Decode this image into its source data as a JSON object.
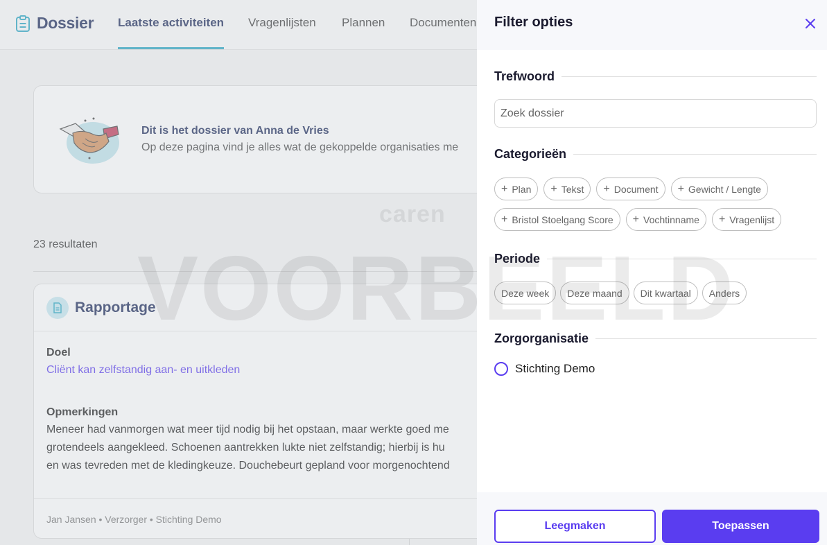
{
  "header": {
    "brand": "Dossier",
    "tabs": [
      {
        "label": "Laatste activiteiten",
        "active": true
      },
      {
        "label": "Vragenlijsten"
      },
      {
        "label": "Plannen"
      },
      {
        "label": "Documenten"
      }
    ]
  },
  "intro": {
    "title": "Dit is het dossier van Anna de Vries",
    "text": "Op deze pagina vind je alles wat de gekoppelde organisaties me"
  },
  "watermarks": {
    "logo": "caren",
    "overlay": "VOORBEELD"
  },
  "results": "23 resultaten",
  "report": {
    "title": "Rapportage",
    "doel_label": "Doel",
    "doel_value": "Cliënt kan zelfstandig aan- en uitkleden",
    "opmerkingen_label": "Opmerkingen",
    "opmerkingen_lines": [
      "Meneer had vanmorgen wat meer tijd nodig bij het opstaan, maar werkte goed me",
      "grotendeels aangekleed. Schoenen aantrekken lukte niet zelfstandig; hierbij is hu",
      "en was tevreden met de kledingkeuze. Douchebeurt gepland voor morgenochtend"
    ],
    "footer": "Jan Jansen • Verzorger •  Stichting Demo"
  },
  "filter": {
    "title": "Filter opties",
    "trefwoord": {
      "title": "Trefwoord",
      "placeholder": "Zoek dossier"
    },
    "categories": {
      "title": "Categorieën",
      "row1": [
        "Plan",
        "Tekst",
        "Document",
        "Gewicht / Lengte"
      ],
      "row2": [
        "Bristol Stoelgang Score",
        "Vochtinname",
        "Vragenlijst"
      ]
    },
    "periode": {
      "title": "Periode",
      "options": [
        "Deze week",
        "Deze maand",
        "Dit kwartaal",
        "Anders"
      ]
    },
    "zorgorganisatie": {
      "title": "Zorgorganisatie",
      "option": "Stichting Demo"
    },
    "clear_label": "Leegmaken",
    "apply_label": "Toepassen"
  },
  "colors": {
    "accent": "#5a3df0",
    "navy": "#1f2d5c",
    "teal": "#2aa7c4"
  }
}
